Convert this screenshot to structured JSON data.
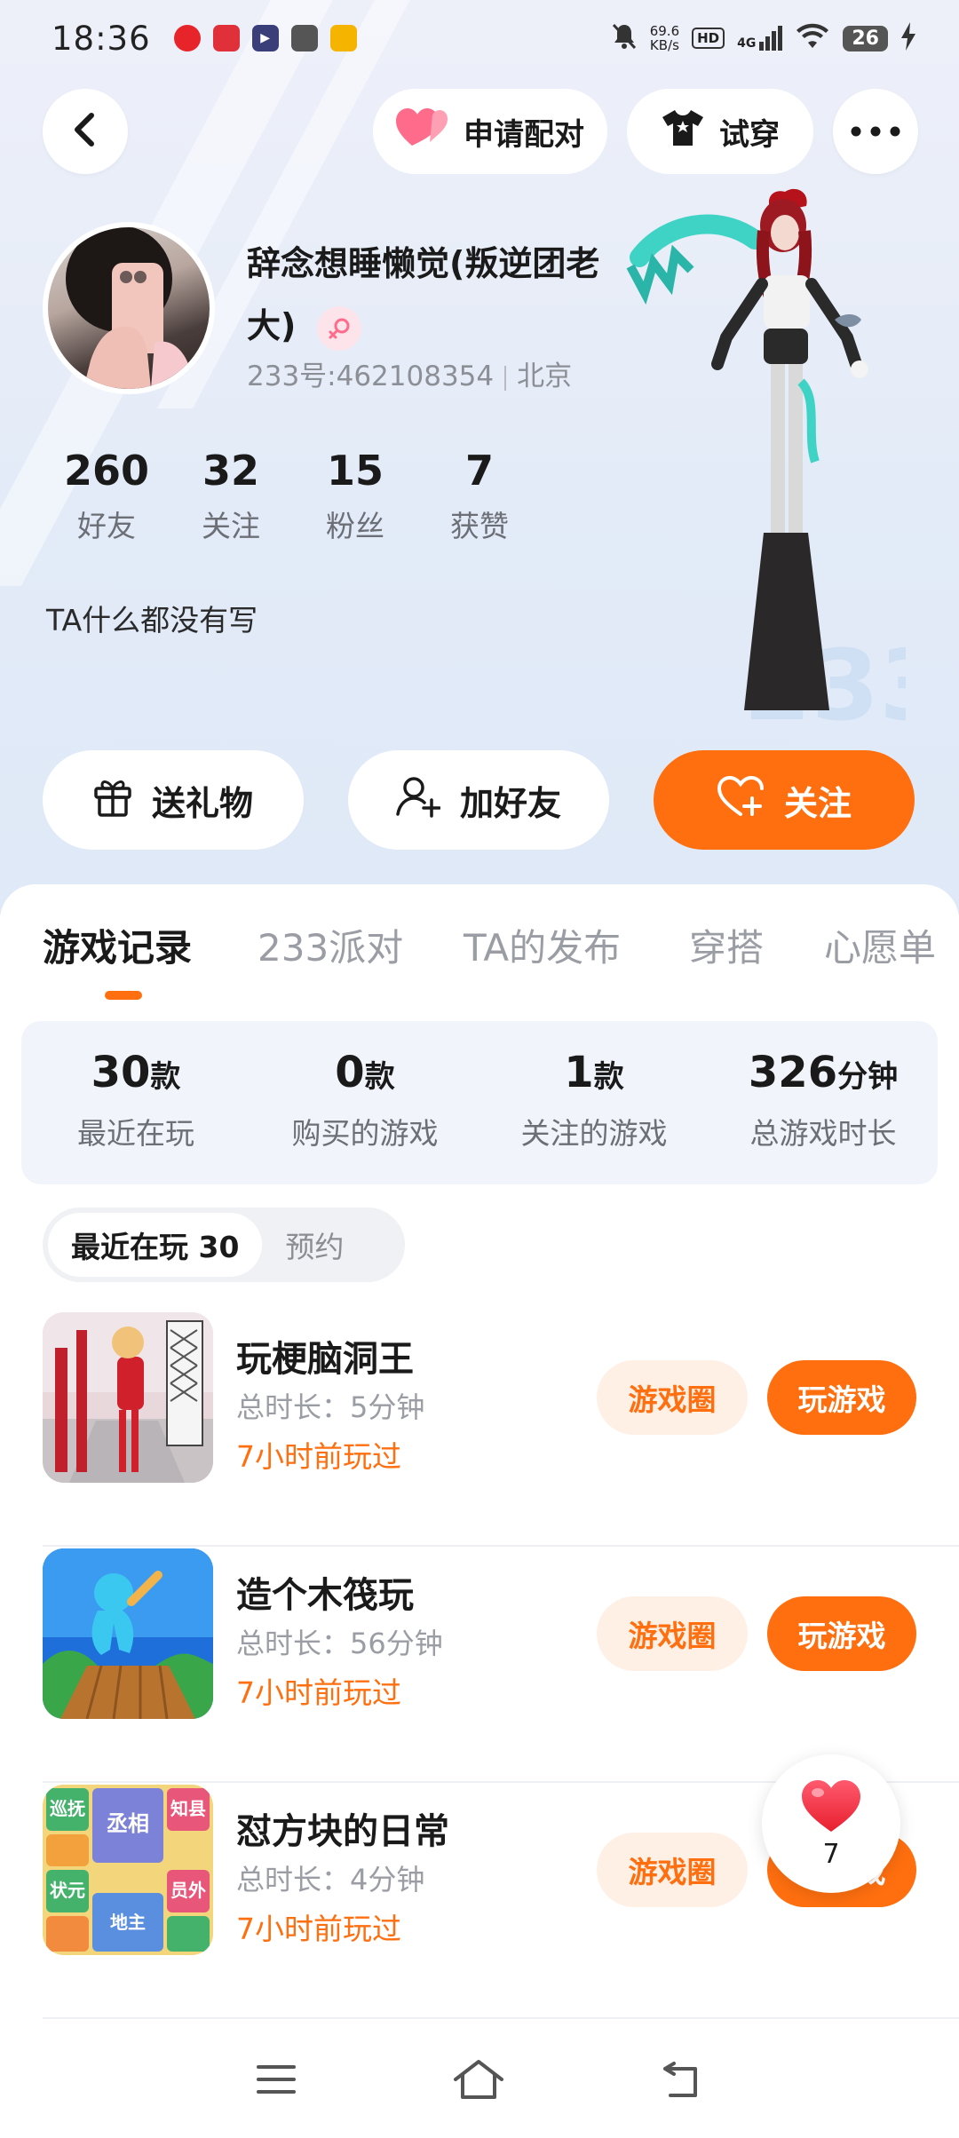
{
  "status": {
    "time": "18:36",
    "net_speed_value": "69.6",
    "net_speed_unit": "KB/s",
    "hd": "HD",
    "signal": "4G",
    "battery": "26"
  },
  "nav": {
    "match_label": "申请配对",
    "tryon_label": "试穿"
  },
  "profile": {
    "name": "辞念想睡懒觉(叛逆团老大)",
    "id_text": "233号:462108354",
    "location": "北京",
    "bio": "TA什么都没有写",
    "watermark": "233"
  },
  "stats": [
    {
      "value": "260",
      "label": "好友"
    },
    {
      "value": "32",
      "label": "关注"
    },
    {
      "value": "15",
      "label": "粉丝"
    },
    {
      "value": "7",
      "label": "获赞"
    }
  ],
  "actions": {
    "gift": "送礼物",
    "add_friend": "加好友",
    "follow": "关注"
  },
  "tabs": [
    "游戏记录",
    "233派对",
    "TA的发布",
    "穿搭",
    "心愿单"
  ],
  "summary": [
    {
      "value": "30",
      "unit": "款",
      "label": "最近在玩"
    },
    {
      "value": "0",
      "unit": "款",
      "label": "购买的游戏"
    },
    {
      "value": "1",
      "unit": "款",
      "label": "关注的游戏"
    },
    {
      "value": "326",
      "unit": "分钟",
      "label": "总游戏时长"
    }
  ],
  "subtabs": {
    "recent": "最近在玩 30",
    "reserve": "预约"
  },
  "games": [
    {
      "title": "玩梗脑洞王",
      "time": "总时长：5分钟",
      "ago": "7小时前玩过"
    },
    {
      "title": "造个木筏玩",
      "time": "总时长：56分钟",
      "ago": "7小时前玩过"
    },
    {
      "title": "怼方块的日常",
      "time": "总时长：4分钟",
      "ago": "7小时前玩过"
    }
  ],
  "game_buttons": {
    "circle": "游戏圈",
    "play": "玩游戏"
  },
  "game3_tiles": [
    "巡抚",
    "丞相",
    "知县",
    "状元",
    "员外",
    "地主"
  ],
  "like_float": {
    "count": "7"
  },
  "colors": {
    "accent": "#ff6f0f",
    "accent_light": "#fff0e6",
    "hero_bg": "#e3ebf8",
    "summary_bg": "#f1f5fb"
  }
}
